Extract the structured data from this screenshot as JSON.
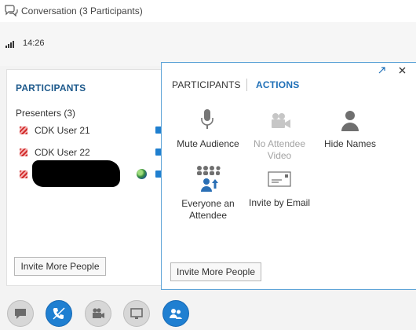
{
  "window": {
    "title": "Conversation (3 Participants)"
  },
  "status": {
    "time": "14:26"
  },
  "roster": {
    "heading": "PARTICIPANTS",
    "group_label": "Presenters (3)",
    "people": [
      {
        "name": "CDK User 21"
      },
      {
        "name": "CDK User 22"
      }
    ],
    "invite_button": "Invite More People"
  },
  "popup": {
    "tabs": {
      "participants": "PARTICIPANTS",
      "actions": "ACTIONS"
    },
    "actions": {
      "mute": {
        "label": "Mute Audience",
        "icon": "microphone-icon"
      },
      "video": {
        "label_line1": "No Attendee",
        "label_line2": "Video",
        "icon": "video-camera-icon",
        "disabled": true
      },
      "hide": {
        "label": "Hide Names",
        "icon": "person-icon"
      },
      "everyone": {
        "label_line1": "Everyone an",
        "label_line2": "Attendee",
        "icon": "group-arrow-icon"
      },
      "email": {
        "label": "Invite by Email",
        "icon": "email-icon"
      }
    },
    "invite_button": "Invite More People"
  },
  "toolbar": {
    "buttons": [
      {
        "icon": "chat-bubble-icon"
      },
      {
        "icon": "phone-muted-icon",
        "active": true
      },
      {
        "icon": "video-camera-icon"
      },
      {
        "icon": "present-screen-icon"
      },
      {
        "icon": "people-icon",
        "active": true
      }
    ]
  },
  "colors": {
    "accent": "#1f7fd1",
    "heading": "#1e5a8c",
    "presence_busy": "#d12b2b"
  }
}
